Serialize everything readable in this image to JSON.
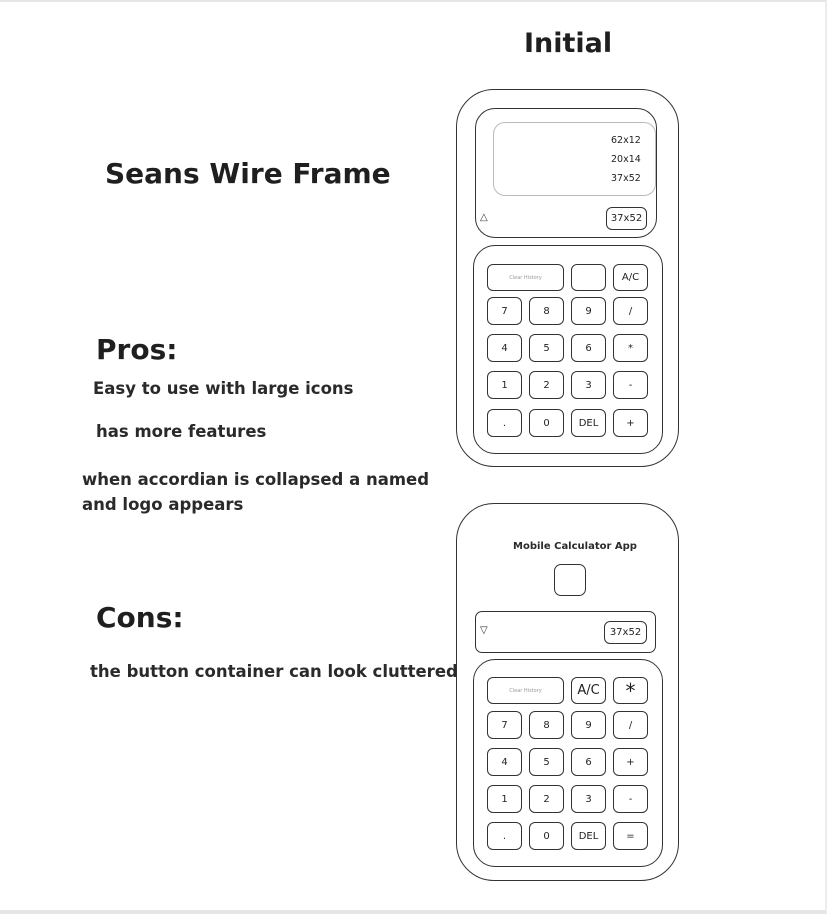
{
  "title": "Initial",
  "wireframe_title": "Seans Wire Frame",
  "pros": {
    "heading": "Pros:",
    "items": [
      "Easy to use with large icons",
      "has more features"
    ],
    "note_lines": [
      "when accordian is collapsed a named",
      "and logo appears"
    ]
  },
  "cons": {
    "heading": "Cons:",
    "items": [
      "the button container can look cluttered"
    ]
  },
  "phone1": {
    "history": [
      "62x12",
      "20x14",
      "37x52"
    ],
    "display_value": "37x52",
    "toggle_icon": "up-triangle-icon",
    "toggle_glyph": "△",
    "top_row": [
      "Clear History",
      "",
      "A/C"
    ],
    "rows": [
      [
        "7",
        "8",
        "9",
        "/"
      ],
      [
        "4",
        "5",
        "6",
        "*"
      ],
      [
        "1",
        "2",
        "3",
        "-"
      ],
      [
        ".",
        "0",
        "DEL",
        "+"
      ]
    ]
  },
  "phone2": {
    "app_name": "Mobile Calculator App",
    "display_value": "37x52",
    "toggle_icon": "down-triangle-icon",
    "toggle_glyph": "▽",
    "top_row": [
      "Clear History",
      "A/C",
      "*"
    ],
    "rows": [
      [
        "7",
        "8",
        "9",
        "/"
      ],
      [
        "4",
        "5",
        "6",
        "+"
      ],
      [
        "1",
        "2",
        "3",
        "-"
      ],
      [
        ".",
        "0",
        "DEL",
        "="
      ]
    ]
  }
}
